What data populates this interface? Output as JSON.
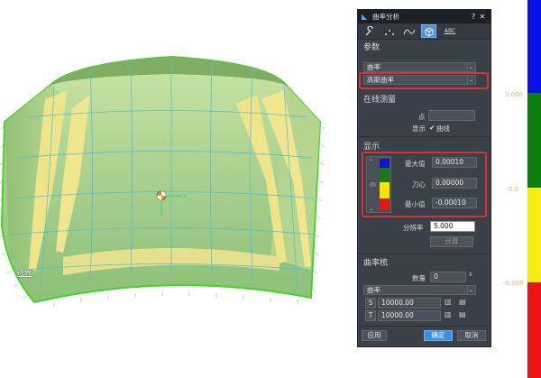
{
  "viewport": {
    "edge_label": "边界",
    "axis_label": "Y"
  },
  "dialog": {
    "title": "曲率分析",
    "help": "?",
    "close": "✕",
    "toolbar": {
      "tools": [
        {
          "name": "wrench-icon"
        },
        {
          "name": "points-icon"
        },
        {
          "name": "curve-icon"
        },
        {
          "name": "surface-icon"
        },
        {
          "name": "abc-text-icon"
        }
      ],
      "abc_label": "ABC"
    },
    "params": {
      "title": "参数",
      "mode_value": "曲率",
      "type_value": "高斯曲率"
    },
    "online": {
      "title": "在线测量",
      "point_label": "点",
      "point_value": "",
      "display_label": "显示",
      "curve_check": "✔",
      "curve_label": "曲线"
    },
    "display": {
      "title": "显示",
      "max_label": "最大值",
      "max_value": "0.00010",
      "center_label": "刀心",
      "center_value": "0.00000",
      "min_label": "最小值",
      "min_value": "-0.00010",
      "scale_colors": [
        "#1515c8",
        "#1a7a1a",
        "#f5e600",
        "#e01818"
      ],
      "resolution_label": "分辨率",
      "resolution_value": "5.000",
      "calc_button": "计算"
    },
    "comb": {
      "title": "曲率梳",
      "count_label": "数量",
      "count_value": "0",
      "type_value": "曲率",
      "s_label": "S",
      "s_value": "10000.00",
      "t_label": "T",
      "t_value": "10000.00"
    },
    "footer": {
      "apply": "应用",
      "ok": "确定",
      "cancel": "取消"
    }
  },
  "colorbar": {
    "colors": [
      "#0a10e8",
      "#0b7e0e",
      "#f6ee12",
      "#ef1414"
    ],
    "labels": [
      "0.000",
      "0.0",
      "-0.000"
    ]
  }
}
